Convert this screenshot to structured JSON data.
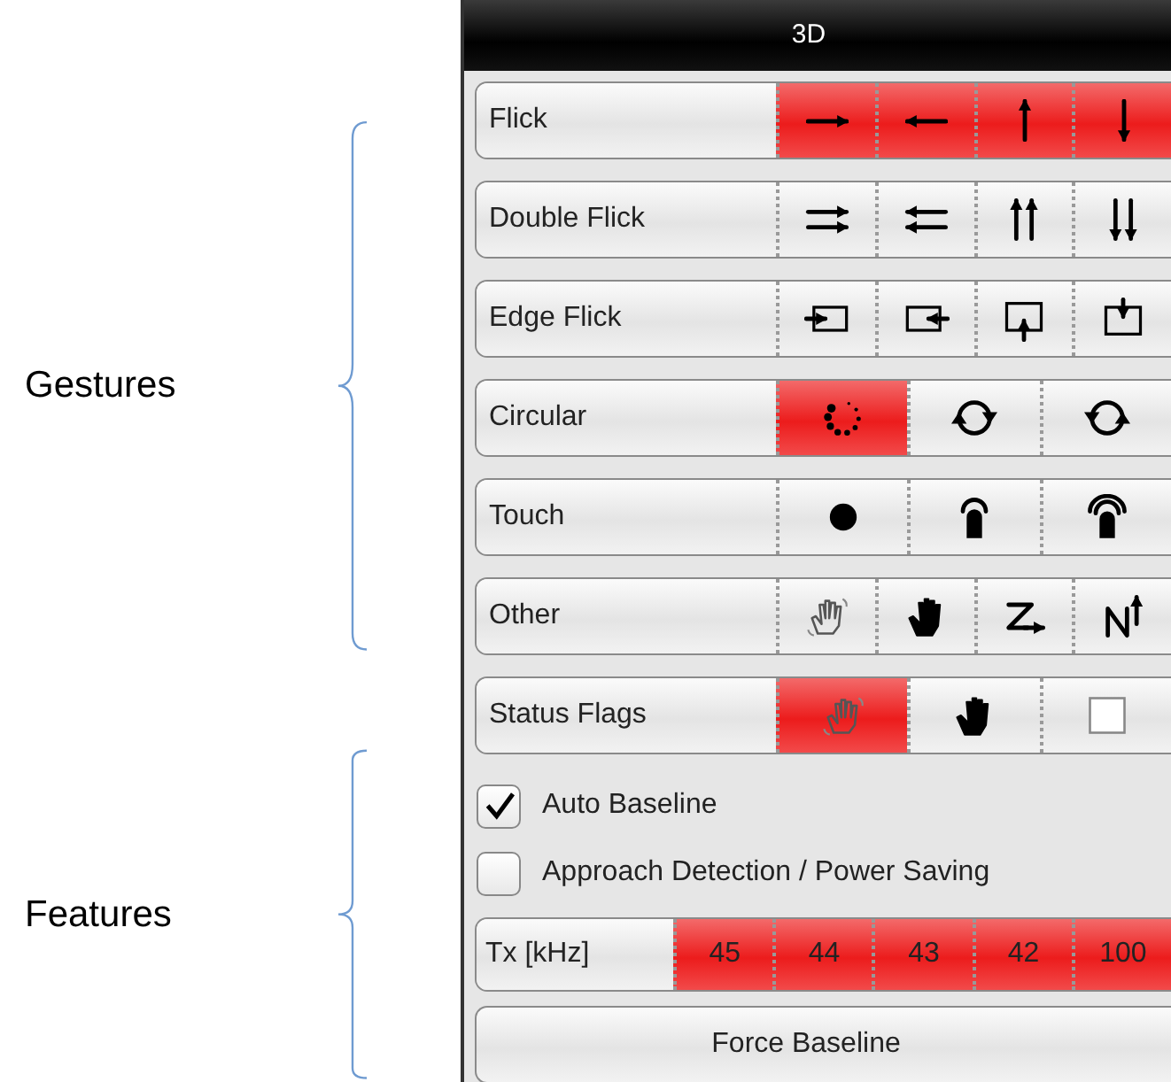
{
  "annotations": [
    {
      "label": "Gestures"
    },
    {
      "label": "Features"
    }
  ],
  "panel": {
    "title": "3D",
    "gesture_rows": [
      {
        "label": "Flick",
        "cells": [
          {
            "kind": "right",
            "on": true
          },
          {
            "kind": "left",
            "on": true
          },
          {
            "kind": "up",
            "on": true
          },
          {
            "kind": "down",
            "on": true
          }
        ]
      },
      {
        "label": "Double Flick",
        "cells": [
          {
            "kind": "double-right",
            "on": false
          },
          {
            "kind": "double-left",
            "on": false
          },
          {
            "kind": "double-up",
            "on": false
          },
          {
            "kind": "double-down",
            "on": false
          }
        ]
      },
      {
        "label": "Edge Flick",
        "cells": [
          {
            "kind": "edge-left",
            "on": false
          },
          {
            "kind": "edge-right",
            "on": false
          },
          {
            "kind": "edge-bottom",
            "on": false
          },
          {
            "kind": "edge-top",
            "on": false
          }
        ]
      },
      {
        "label": "Circular",
        "cells": [
          {
            "kind": "dots-circle",
            "on": true
          },
          {
            "kind": "clockwise",
            "on": false
          },
          {
            "kind": "counterclockwise",
            "on": false
          }
        ]
      },
      {
        "label": "Touch",
        "cells": [
          {
            "kind": "dot",
            "on": false
          },
          {
            "kind": "finger",
            "on": false
          },
          {
            "kind": "finger-double",
            "on": false
          }
        ]
      },
      {
        "label": "Other",
        "cells": [
          {
            "kind": "wave-hand",
            "on": false
          },
          {
            "kind": "hand",
            "on": false
          },
          {
            "kind": "z-arrow",
            "on": false
          },
          {
            "kind": "n-arrow",
            "on": false
          }
        ]
      },
      {
        "label": "Status Flags",
        "cells": [
          {
            "kind": "wave-hand",
            "on": true
          },
          {
            "kind": "hand",
            "on": false
          },
          {
            "kind": "square",
            "on": false
          }
        ]
      }
    ],
    "checkboxes": [
      {
        "label": "Auto Baseline",
        "checked": true
      },
      {
        "label": "Approach Detection / Power Saving",
        "checked": false
      }
    ],
    "tx": {
      "label": "Tx [kHz]",
      "cells": [
        {
          "text": "45",
          "on": true
        },
        {
          "text": "44",
          "on": true
        },
        {
          "text": "43",
          "on": true
        },
        {
          "text": "42",
          "on": true
        },
        {
          "text": "100",
          "on": true
        }
      ]
    },
    "button": "Force Baseline"
  }
}
